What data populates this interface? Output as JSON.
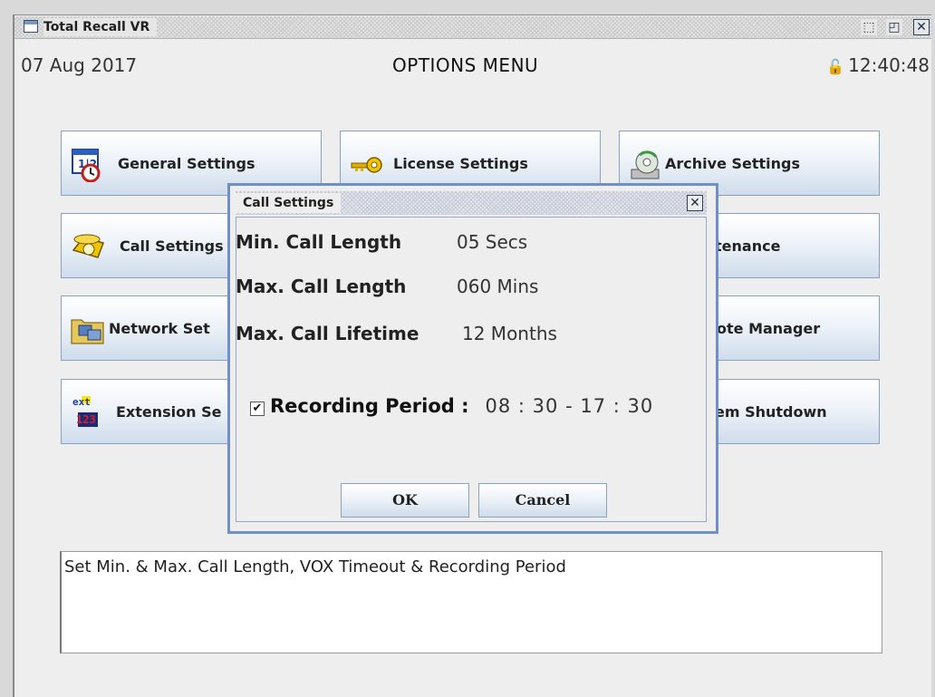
{
  "window": {
    "title": "Total Recall VR",
    "minimize_glyph": "⬚",
    "maximize_glyph": "◰",
    "close_glyph": "✕"
  },
  "header": {
    "date": "07 Aug 2017",
    "menu_title": "OPTIONS MENU",
    "time": "12:40:48",
    "lock_glyph": "🔓"
  },
  "menu_buttons": [
    {
      "label": "General Settings",
      "icon": "calendar-clock-icon"
    },
    {
      "label": "License Settings",
      "icon": "key-icon"
    },
    {
      "label": "Archive Settings",
      "icon": "disc-archive-icon"
    },
    {
      "label": "Call Settings",
      "icon": "telephone-icon"
    },
    {
      "label": "Maintenance",
      "visible": "tenance",
      "icon": "maintenance-icon"
    },
    {
      "label": "Network Settings",
      "visible": "Network Set",
      "icon": "network-computer-icon"
    },
    {
      "label": "Remote Manager",
      "visible": "ote Manager",
      "icon": "remote-icon"
    },
    {
      "label": "Extension Settings",
      "visible": "Extension Se",
      "icon": "ext-123-icon"
    },
    {
      "label": "System Shutdown",
      "visible": "em Shutdown",
      "icon": "shutdown-icon"
    }
  ],
  "description": "Set Min. & Max. Call Length, VOX Timeout & Recording Period",
  "dialog": {
    "title": "Call Settings",
    "close_glyph": "✕",
    "min_call_length_label": "Min. Call Length",
    "min_call_length_value": "05 Secs",
    "max_call_length_label": "Max. Call Length",
    "max_call_length_value": "060 Mins",
    "max_call_lifetime_label": "Max. Call Lifetime",
    "max_call_lifetime_value": "12 Months",
    "recording_period_checked": true,
    "recording_period_label": "Recording Period :",
    "recording_period_value": "08 : 30  -  17 : 30",
    "ok_label": "OK",
    "cancel_label": "Cancel"
  },
  "colors": {
    "dialog_border": "#6f8fc5",
    "button_gradient_end": "#cfdceb",
    "frame_bg": "#eeeeee"
  }
}
